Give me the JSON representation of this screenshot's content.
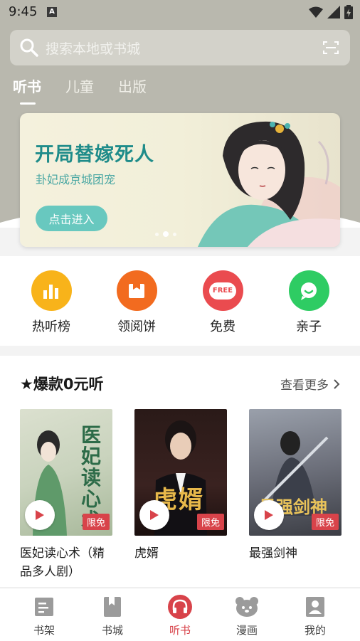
{
  "status": {
    "time": "9:45",
    "notif_letter": "A"
  },
  "search": {
    "placeholder": "搜索本地或书城"
  },
  "tabs": [
    {
      "label": "听书",
      "active": true
    },
    {
      "label": "儿童",
      "active": false
    },
    {
      "label": "出版",
      "active": false
    }
  ],
  "banner": {
    "title": "开局替嫁死人",
    "subtitle": "卦妃成京城团宠",
    "button": "点击进入",
    "dots": 3,
    "active_dot": 2
  },
  "quick": [
    {
      "label": "热听榜",
      "icon": "bar-chart-icon",
      "color": "#f8b31a"
    },
    {
      "label": "领阅饼",
      "icon": "coupon-icon",
      "color": "#f26b1f"
    },
    {
      "label": "免费",
      "icon": "free-icon",
      "color": "#ea4b4f",
      "icon_text": "FREE"
    },
    {
      "label": "亲子",
      "icon": "chat-bubble-icon",
      "color": "#2ecc63"
    }
  ],
  "section": {
    "title": "★爆款0元听",
    "more": "查看更多"
  },
  "books": [
    {
      "title": "医妃读心术（精品多人剧）",
      "badge": "限免",
      "cover_text": "医妃读心术"
    },
    {
      "title": "虎婿",
      "badge": "限免",
      "cover_text": "虎婿"
    },
    {
      "title": "最强剑神",
      "badge": "限免",
      "cover_text": "最强剑神"
    }
  ],
  "nav": [
    {
      "label": "书架",
      "icon": "bookshelf-icon",
      "active": false
    },
    {
      "label": "书城",
      "icon": "bookstore-icon",
      "active": false
    },
    {
      "label": "听书",
      "icon": "headphones-icon",
      "active": true
    },
    {
      "label": "漫画",
      "icon": "bear-icon",
      "active": false
    },
    {
      "label": "我的",
      "icon": "profile-icon",
      "active": false
    }
  ],
  "colors": {
    "accent": "#d8434a",
    "banner_title": "#1f8c8a",
    "banner_button": "#68c8bf"
  }
}
